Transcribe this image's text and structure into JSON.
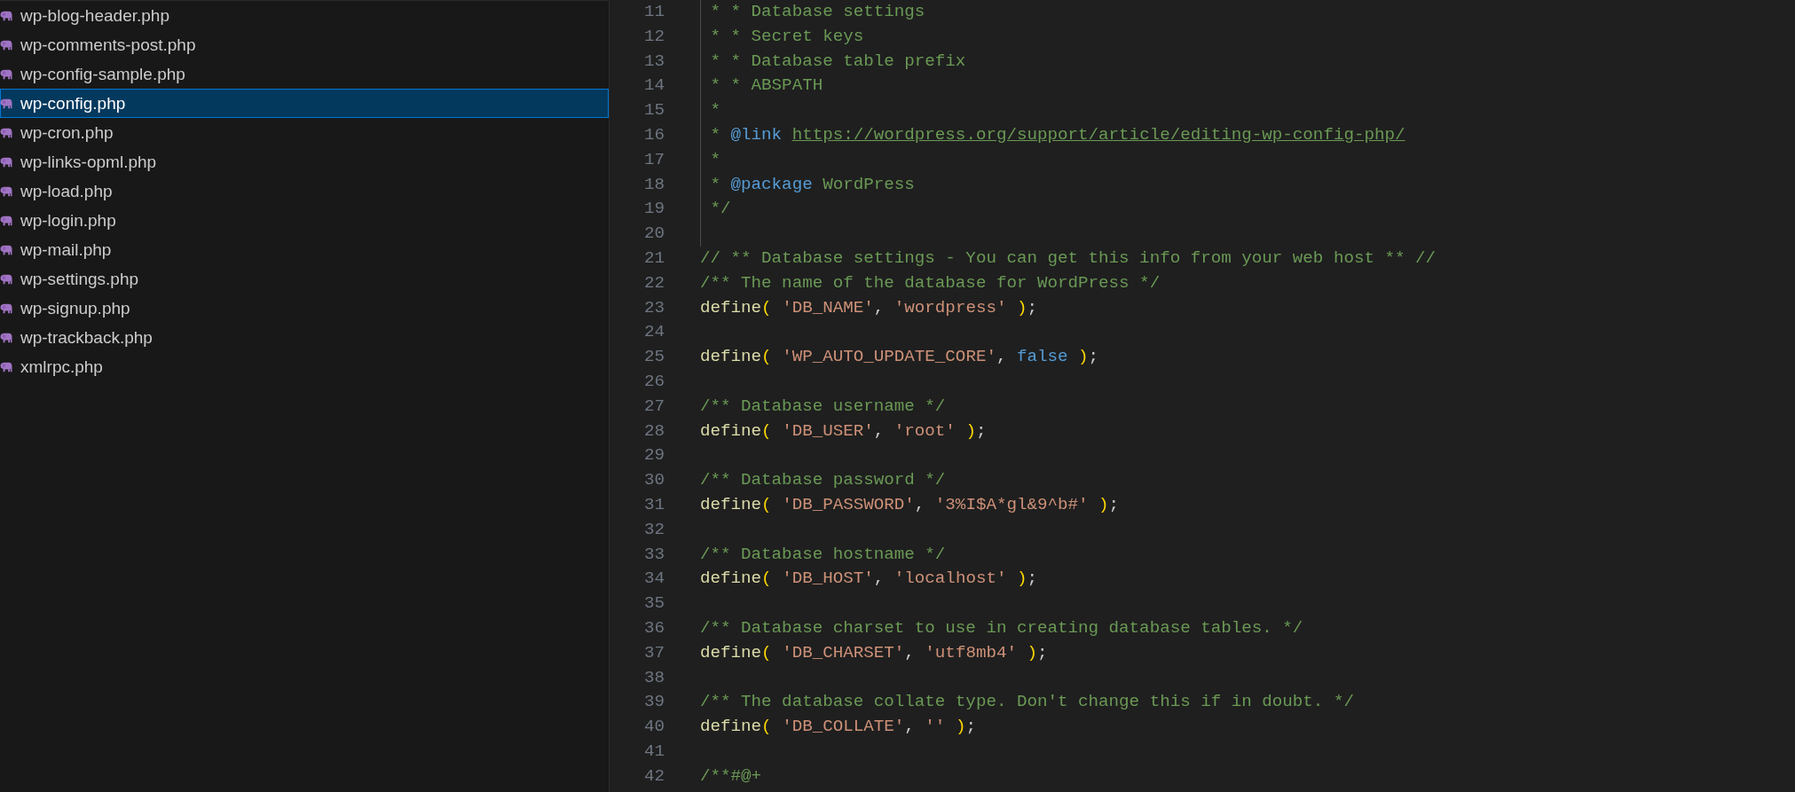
{
  "sidebar": {
    "files": [
      {
        "name": "wp-blog-header.php",
        "selected": false
      },
      {
        "name": "wp-comments-post.php",
        "selected": false
      },
      {
        "name": "wp-config-sample.php",
        "selected": false
      },
      {
        "name": "wp-config.php",
        "selected": true
      },
      {
        "name": "wp-cron.php",
        "selected": false
      },
      {
        "name": "wp-links-opml.php",
        "selected": false
      },
      {
        "name": "wp-load.php",
        "selected": false
      },
      {
        "name": "wp-login.php",
        "selected": false
      },
      {
        "name": "wp-mail.php",
        "selected": false
      },
      {
        "name": "wp-settings.php",
        "selected": false
      },
      {
        "name": "wp-signup.php",
        "selected": false
      },
      {
        "name": "wp-trackback.php",
        "selected": false
      },
      {
        "name": "xmlrpc.php",
        "selected": false
      }
    ]
  },
  "editor": {
    "lines": [
      {
        "number": "11",
        "indent_guide": true,
        "tokens": [
          {
            "kind": "comment",
            "text": " * * Database settings"
          }
        ]
      },
      {
        "number": "12",
        "indent_guide": true,
        "tokens": [
          {
            "kind": "comment",
            "text": " * * Secret keys"
          }
        ]
      },
      {
        "number": "13",
        "indent_guide": true,
        "tokens": [
          {
            "kind": "comment",
            "text": " * * Database table prefix"
          }
        ]
      },
      {
        "number": "14",
        "indent_guide": true,
        "tokens": [
          {
            "kind": "comment",
            "text": " * * ABSPATH"
          }
        ]
      },
      {
        "number": "15",
        "indent_guide": true,
        "tokens": [
          {
            "kind": "comment",
            "text": " *"
          }
        ]
      },
      {
        "number": "16",
        "indent_guide": true,
        "tokens": [
          {
            "kind": "comment",
            "text": " * "
          },
          {
            "kind": "doctag",
            "text": "@link "
          },
          {
            "kind": "link",
            "text": "https://wordpress.org/support/article/editing-wp-config-php/"
          }
        ]
      },
      {
        "number": "17",
        "indent_guide": true,
        "tokens": [
          {
            "kind": "comment",
            "text": " *"
          }
        ]
      },
      {
        "number": "18",
        "indent_guide": true,
        "tokens": [
          {
            "kind": "comment",
            "text": " * "
          },
          {
            "kind": "doctag",
            "text": "@package"
          },
          {
            "kind": "comment",
            "text": " WordPress"
          }
        ]
      },
      {
        "number": "19",
        "indent_guide": true,
        "tokens": [
          {
            "kind": "comment",
            "text": " */"
          }
        ]
      },
      {
        "number": "20",
        "indent_guide": true
      },
      {
        "number": "21",
        "indent_guide": false,
        "tokens": [
          {
            "kind": "comment",
            "text": "// ** Database settings - You can get this info from your web host ** //"
          }
        ]
      },
      {
        "number": "22",
        "indent_guide": false,
        "tokens": [
          {
            "kind": "comment",
            "text": "/** The name of the database for WordPress */"
          }
        ]
      },
      {
        "number": "23",
        "indent_guide": false,
        "tokens": [
          {
            "kind": "function",
            "text": "define"
          },
          {
            "kind": "paren",
            "text": "( "
          },
          {
            "kind": "string",
            "text": "'DB_NAME'"
          },
          {
            "kind": "punct",
            "text": ", "
          },
          {
            "kind": "string",
            "text": "'wordpress'"
          },
          {
            "kind": "paren",
            "text": " )"
          },
          {
            "kind": "punct",
            "text": ";"
          }
        ]
      },
      {
        "number": "24",
        "indent_guide": false
      },
      {
        "number": "25",
        "indent_guide": false,
        "tokens": [
          {
            "kind": "function",
            "text": "define"
          },
          {
            "kind": "paren",
            "text": "( "
          },
          {
            "kind": "string",
            "text": "'WP_AUTO_UPDATE_CORE'"
          },
          {
            "kind": "punct",
            "text": ", "
          },
          {
            "kind": "constant",
            "text": "false"
          },
          {
            "kind": "paren",
            "text": " )"
          },
          {
            "kind": "punct",
            "text": ";"
          }
        ]
      },
      {
        "number": "26",
        "indent_guide": false
      },
      {
        "number": "27",
        "indent_guide": false,
        "tokens": [
          {
            "kind": "comment",
            "text": "/** Database username */"
          }
        ]
      },
      {
        "number": "28",
        "indent_guide": false,
        "tokens": [
          {
            "kind": "function",
            "text": "define"
          },
          {
            "kind": "paren",
            "text": "( "
          },
          {
            "kind": "string",
            "text": "'DB_USER'"
          },
          {
            "kind": "punct",
            "text": ", "
          },
          {
            "kind": "string",
            "text": "'root'"
          },
          {
            "kind": "paren",
            "text": " )"
          },
          {
            "kind": "punct",
            "text": ";"
          }
        ]
      },
      {
        "number": "29",
        "indent_guide": false
      },
      {
        "number": "30",
        "indent_guide": false,
        "tokens": [
          {
            "kind": "comment",
            "text": "/** Database password */"
          }
        ]
      },
      {
        "number": "31",
        "indent_guide": false,
        "tokens": [
          {
            "kind": "function",
            "text": "define"
          },
          {
            "kind": "paren",
            "text": "( "
          },
          {
            "kind": "string",
            "text": "'DB_PASSWORD'"
          },
          {
            "kind": "punct",
            "text": ", "
          },
          {
            "kind": "string",
            "text": "'3%I$A*gl&9^b#'"
          },
          {
            "kind": "paren",
            "text": " )"
          },
          {
            "kind": "punct",
            "text": ";"
          }
        ]
      },
      {
        "number": "32",
        "indent_guide": false
      },
      {
        "number": "33",
        "indent_guide": false,
        "tokens": [
          {
            "kind": "comment",
            "text": "/** Database hostname */"
          }
        ]
      },
      {
        "number": "34",
        "indent_guide": false,
        "tokens": [
          {
            "kind": "function",
            "text": "define"
          },
          {
            "kind": "paren",
            "text": "( "
          },
          {
            "kind": "string",
            "text": "'DB_HOST'"
          },
          {
            "kind": "punct",
            "text": ", "
          },
          {
            "kind": "string",
            "text": "'localhost'"
          },
          {
            "kind": "paren",
            "text": " )"
          },
          {
            "kind": "punct",
            "text": ";"
          }
        ]
      },
      {
        "number": "35",
        "indent_guide": false
      },
      {
        "number": "36",
        "indent_guide": false,
        "tokens": [
          {
            "kind": "comment",
            "text": "/** Database charset to use in creating database tables. */"
          }
        ]
      },
      {
        "number": "37",
        "indent_guide": false,
        "tokens": [
          {
            "kind": "function",
            "text": "define"
          },
          {
            "kind": "paren",
            "text": "( "
          },
          {
            "kind": "string",
            "text": "'DB_CHARSET'"
          },
          {
            "kind": "punct",
            "text": ", "
          },
          {
            "kind": "string",
            "text": "'utf8mb4'"
          },
          {
            "kind": "paren",
            "text": " )"
          },
          {
            "kind": "punct",
            "text": ";"
          }
        ]
      },
      {
        "number": "38",
        "indent_guide": false
      },
      {
        "number": "39",
        "indent_guide": false,
        "tokens": [
          {
            "kind": "comment",
            "text": "/** The database collate type. Don't change this if in doubt. */"
          }
        ]
      },
      {
        "number": "40",
        "indent_guide": false,
        "tokens": [
          {
            "kind": "function",
            "text": "define"
          },
          {
            "kind": "paren",
            "text": "( "
          },
          {
            "kind": "string",
            "text": "'DB_COLLATE'"
          },
          {
            "kind": "punct",
            "text": ", "
          },
          {
            "kind": "string",
            "text": "''"
          },
          {
            "kind": "paren",
            "text": " )"
          },
          {
            "kind": "punct",
            "text": ";"
          }
        ]
      },
      {
        "number": "41",
        "indent_guide": false
      },
      {
        "number": "42",
        "indent_guide": false,
        "tokens": [
          {
            "kind": "comment",
            "text": "/**#@+"
          }
        ]
      }
    ]
  }
}
